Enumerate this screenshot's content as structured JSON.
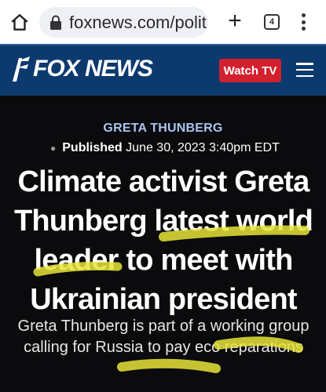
{
  "browser": {
    "url": "foxnews.com/polit",
    "tab_count": "4"
  },
  "header": {
    "logo_text": "FOX NEWS",
    "watch_label": "Watch TV"
  },
  "article": {
    "category": "GRETA THUNBERG",
    "published_label": "Published",
    "published_date": "June 30, 2023 3:40pm EDT",
    "headline": "Climate activist Greta Thunberg latest world leader to meet with Ukrainian president",
    "subheadline": "Greta Thunberg is part of a working group calling for Russia to pay eco reparations"
  },
  "colors": {
    "header_blue": "#0d3a6e",
    "watch_red": "#d3202e",
    "category_blue": "#a9c4ee",
    "highlight": "#e8e43a"
  },
  "icons": [
    "home-icon",
    "lock-icon",
    "plus-icon",
    "tabs-icon",
    "more-vert-icon",
    "fox-logo-icon",
    "hamburger-menu-icon"
  ]
}
